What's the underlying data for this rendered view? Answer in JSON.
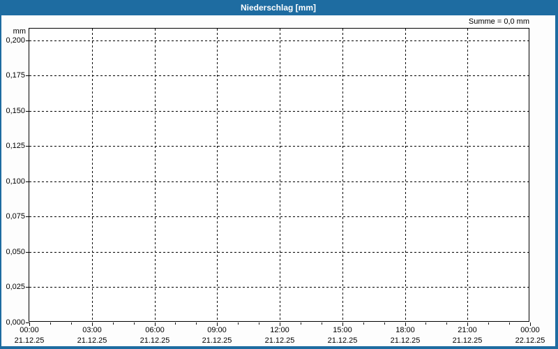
{
  "window": {
    "title": "Niederschlag [mm]"
  },
  "colors": {
    "titlebar": "#1e6ca1",
    "frame": "#1e6ca1",
    "plot_border": "#000000",
    "grid": "#000000",
    "text": "#000000",
    "background": "#ffffff"
  },
  "chart_data": {
    "type": "bar",
    "title": "Niederschlag [mm]",
    "unit_label": "mm",
    "annotation": "Summe = 0,0 mm",
    "grid": "dashed",
    "ylim": [
      0,
      0.2083
    ],
    "y_ticks": [
      {
        "label": "0,200",
        "value": 0.2
      },
      {
        "label": "0,175",
        "value": 0.175
      },
      {
        "label": "0,150",
        "value": 0.15
      },
      {
        "label": "0,125",
        "value": 0.125
      },
      {
        "label": "0,100",
        "value": 0.1
      },
      {
        "label": "0,075",
        "value": 0.075
      },
      {
        "label": "0,050",
        "value": 0.05
      },
      {
        "label": "0,025",
        "value": 0.025
      },
      {
        "label": "0,000",
        "value": 0.0
      }
    ],
    "xlim_hours": [
      0,
      24
    ],
    "x_major_step_hours": 3,
    "x_minor_step_hours": 1,
    "x_ticks": [
      {
        "time": "00:00",
        "date": "21.12.25",
        "hour": 0
      },
      {
        "time": "03:00",
        "date": "21.12.25",
        "hour": 3
      },
      {
        "time": "06:00",
        "date": "21.12.25",
        "hour": 6
      },
      {
        "time": "09:00",
        "date": "21.12.25",
        "hour": 9
      },
      {
        "time": "12:00",
        "date": "21.12.25",
        "hour": 12
      },
      {
        "time": "15:00",
        "date": "21.12.25",
        "hour": 15
      },
      {
        "time": "18:00",
        "date": "21.12.25",
        "hour": 18
      },
      {
        "time": "21:00",
        "date": "21.12.25",
        "hour": 21
      },
      {
        "time": "00:00",
        "date": "22.12.25",
        "hour": 24
      }
    ],
    "series": [
      {
        "name": "Niederschlag",
        "values": [],
        "total_mm": 0.0
      }
    ]
  }
}
